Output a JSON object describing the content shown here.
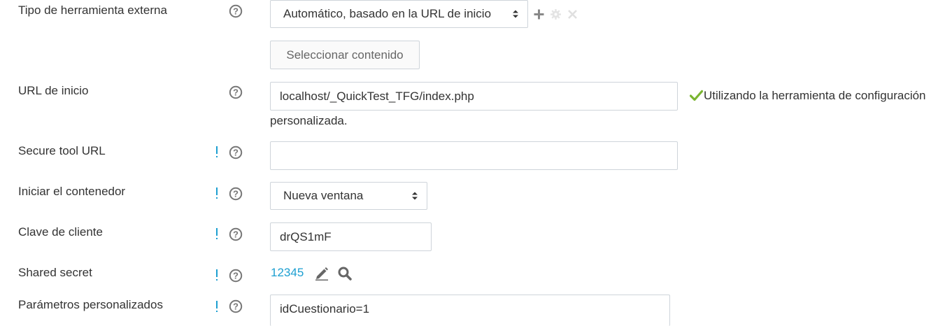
{
  "fields": {
    "tool_type": {
      "label": "Tipo de herramienta externa",
      "selected": "Automático, basado en la URL de inicio",
      "select_content_button": "Seleccionar contenido"
    },
    "tool_url": {
      "label": "URL de inicio",
      "value": "localhost/_QuickTest_TFG/index.php",
      "message_line1": "Utilizando la herramienta de configuración",
      "message_line2": "personalizada."
    },
    "secure_url": {
      "label": "Secure tool URL",
      "value": ""
    },
    "launch_container": {
      "label": "Iniciar el contenedor",
      "selected": "Nueva ventana"
    },
    "consumer_key": {
      "label": "Clave de cliente",
      "value": "drQS1mF"
    },
    "shared_secret": {
      "label": "Shared secret",
      "value": "12345"
    },
    "custom_params": {
      "label": "Parámetros personalizados",
      "value": "idCuestionario=1"
    }
  },
  "markers": {
    "advanced": "!"
  },
  "icons": [
    "help-icon",
    "add-icon",
    "gear-icon",
    "close-icon",
    "checkmark-icon",
    "edit-icon",
    "search-icon",
    "select-arrows-icon"
  ],
  "colors": {
    "link": "#1d9fd1",
    "advanced_marker": "#1d9fd1",
    "success": "#7ab531",
    "help": "#777777"
  }
}
